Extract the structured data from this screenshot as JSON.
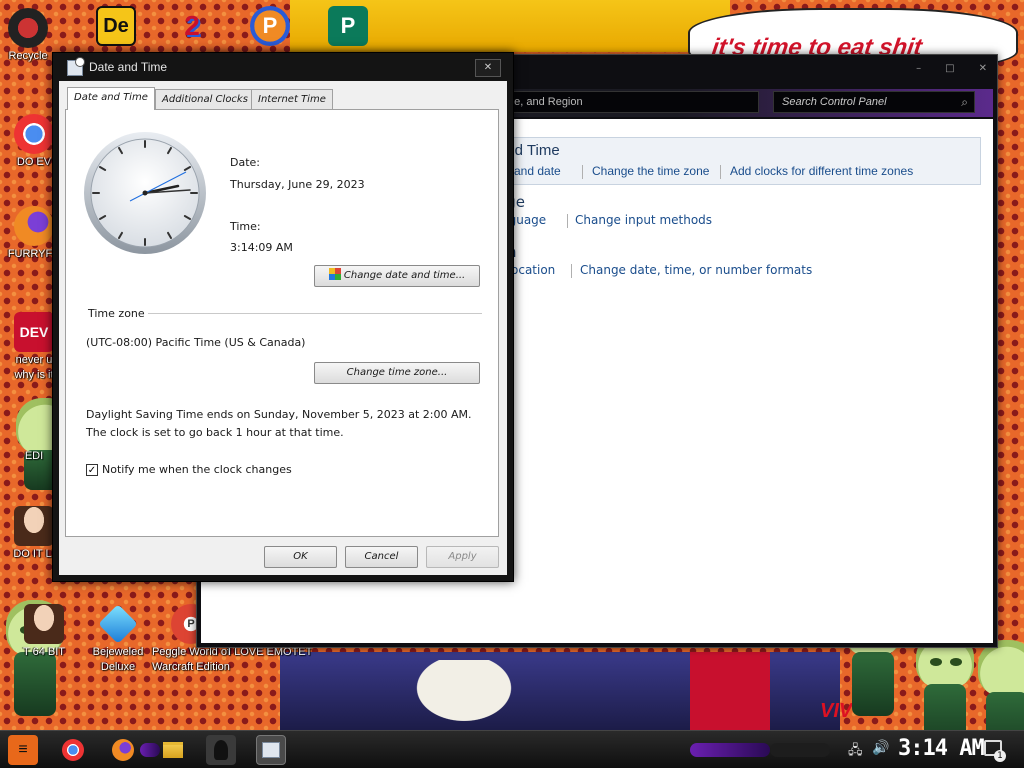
{
  "wallpaper": {
    "bubble_text": "it's time to eat shit",
    "vivid_text": "VIV"
  },
  "desktop_icons": [
    {
      "label": "Recycle",
      "icon": "recycle-bin-icon"
    },
    {
      "label": "DO EV",
      "icon": "chrome-icon"
    },
    {
      "label": "FURRYFU",
      "icon": "firefox-icon"
    },
    {
      "label": "never u",
      "icon": "dev-cpp-icon",
      "label2": "why is it"
    },
    {
      "label": "EDI",
      "icon": "peridot-icon"
    },
    {
      "label": "DO IT LI",
      "icon": "portrait-icon"
    },
    {
      "label": "T 64 BIT",
      "icon": "portrait-icon-2"
    },
    {
      "label": "Bejeweled",
      "label2": "Deluxe",
      "icon": "bejeweled-gem-icon"
    },
    {
      "label": "Peggle World of",
      "label2": "Warcraft Edition",
      "icon": "peggle-icon"
    },
    {
      "label": "I LOVE EMOTET",
      "icon": "emotet-icon"
    }
  ],
  "top_icons": [
    {
      "icon": "red-app-icon"
    },
    {
      "label": "De",
      "icon": "de-icon"
    },
    {
      "label": "2",
      "icon": "blue-2-icon"
    },
    {
      "label": "P",
      "icon": "p-app-icon"
    },
    {
      "label": "P",
      "icon": "publisher-icon"
    }
  ],
  "control_panel": {
    "address": "ge, and Region",
    "search_placeholder": "Search Control Panel",
    "caption": {
      "minimize": "–",
      "maximize": "□",
      "close": "✕"
    },
    "sections": [
      {
        "title": "and Time",
        "links": [
          "me and date",
          "Change the time zone",
          "Add clocks for different time zones"
        ]
      },
      {
        "title": "age",
        "links": [
          "nguage",
          "Change input methods"
        ]
      },
      {
        "title": "n",
        "links": [
          "ocation",
          "Change date, time, or number formats"
        ]
      }
    ]
  },
  "dialog": {
    "title": "Date and Time",
    "close": "✕",
    "tabs": [
      "Date and Time",
      "Additional Clocks",
      "Internet Time"
    ],
    "date_label": "Date:",
    "date_value": "Thursday, June 29, 2023",
    "time_label": "Time:",
    "time_value": "3:14:09 AM",
    "change_datetime_button": "Change date and time...",
    "timezone_heading": "Time zone",
    "timezone_value": "(UTC-08:00) Pacific Time (US & Canada)",
    "change_timezone_button": "Change time zone...",
    "dst_line1": "Daylight Saving Time ends on Sunday, November 5, 2023 at 2:00 AM.",
    "dst_line2": "The clock is set to go back 1 hour at that time.",
    "notify_label": "Notify me when the clock changes",
    "notify_checked": true,
    "ok": "OK",
    "cancel": "Cancel",
    "apply": "Apply"
  },
  "taskbar": {
    "clock": "3:14 AM",
    "notification_count": "1",
    "items": [
      "start-icon",
      "chrome-icon",
      "firefox-icon",
      "file-explorer-icon",
      "app-icon",
      "date-time-icon"
    ]
  }
}
